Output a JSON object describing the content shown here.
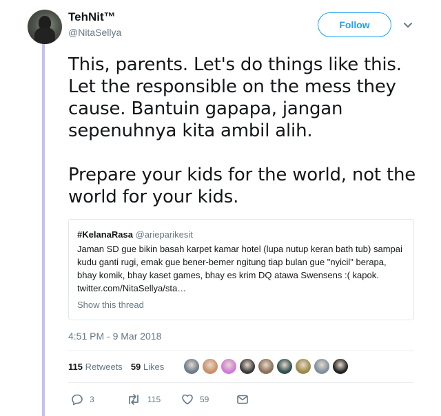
{
  "author": {
    "name": "TehNit™",
    "handle": "@NitaSellya"
  },
  "follow_label": "Follow",
  "tweet": {
    "paragraph1": "This, parents. Let's do things like this. Let the responsible on the mess they cause. Bantuin gapapa, jangan sepenuhnya kita ambil alih.",
    "paragraph2": "Prepare your kids for the world, not the world for your kids."
  },
  "quote": {
    "name": "#KelanaRasa",
    "handle": "@arieparikesit",
    "text": "Jaman SD gue bikin basah karpet kamar hotel (lupa nutup keran bath tub) sampai kudu ganti rugi, emak gue bener-bemer ngitung tiap bulan gue \"nyicil\" berapa, bhay komik, bhay kaset games, bhay es krim DQ atawa Swensens :( kapok. twitter.com/NitaSellya/sta…",
    "show_thread": "Show this thread"
  },
  "timestamp": "4:51 PM - 9 Mar 2018",
  "stats": {
    "retweets_count": "115",
    "retweets_label": "Retweets",
    "likes_count": "59",
    "likes_label": "Likes"
  },
  "likers": [
    "#6a7c8e",
    "#c98f6a",
    "#d07ad8",
    "#3b3b3b",
    "#8a6f5a",
    "#2f4f4f",
    "#9a8a4a",
    "#7d8fa0",
    "#232323"
  ],
  "actions": {
    "replies": "3",
    "retweets": "115",
    "likes": "59"
  },
  "colors": {
    "accent": "#1da1f2",
    "muted": "#657786",
    "thread_line": "#c4c0f0"
  }
}
